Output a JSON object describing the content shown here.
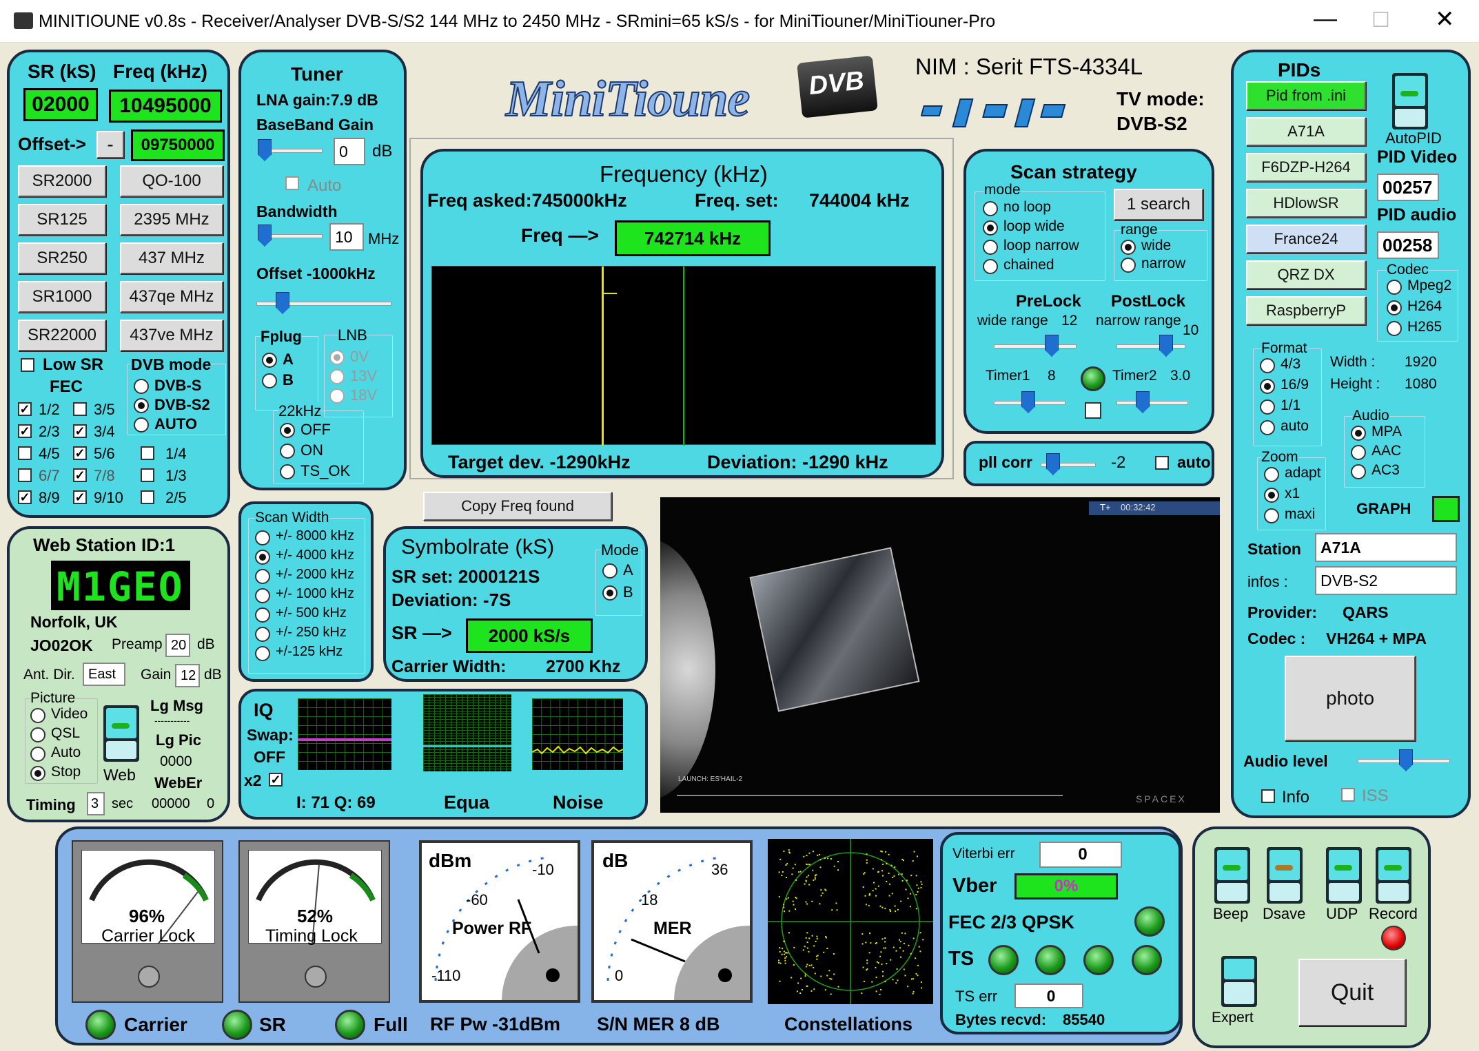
{
  "window": {
    "title": "MINITIOUNE v0.8s - Receiver/Analyser DVB-S/S2 144 MHz to 2450 MHz - SRmini=65 kS/s - for MiniTiouner/MiniTiouner-Pro"
  },
  "logo": {
    "text": "MiniTioune",
    "badge": "DVB"
  },
  "nim": {
    "label": "NIM : Serit FTS-4334L",
    "tv_mode_label": "TV mode:",
    "tv_mode_value": "DVB-S2"
  },
  "sr_freq": {
    "sr_header": "SR (kS)",
    "freq_header": "Freq (kHz)",
    "sr_value": "02000",
    "freq_value": "10495000",
    "offset_label": "Offset->",
    "offset_sign": "-",
    "offset_value": "09750000",
    "sr_buttons": [
      "SR2000",
      "SR125",
      "SR250",
      "SR1000",
      "SR22000"
    ],
    "freq_buttons": [
      "QO-100",
      "2395 MHz",
      "437 MHz",
      "437qe MHz",
      "437ve MHz"
    ],
    "low_sr_label": "Low SR",
    "fec_label": "FEC",
    "fec": [
      {
        "label": "1/2",
        "checked": true
      },
      {
        "label": "3/5",
        "checked": false
      },
      {
        "label": "2/3",
        "checked": true
      },
      {
        "label": "3/4",
        "checked": true
      },
      {
        "label": "4/5",
        "checked": false
      },
      {
        "label": "5/6",
        "checked": true
      },
      {
        "label": "6/7",
        "checked": false
      },
      {
        "label": "7/8",
        "checked": true
      },
      {
        "label": "8/9",
        "checked": true
      },
      {
        "label": "9/10",
        "checked": true
      }
    ],
    "fec_extra": [
      "1/4",
      "1/3",
      "2/5"
    ],
    "dvb_mode_label": "DVB mode",
    "dvb_modes": [
      "DVB-S",
      "DVB-S2",
      "AUTO"
    ],
    "dvb_selected": "DVB-S2"
  },
  "tuner": {
    "title": "Tuner",
    "lna": "LNA gain:7.9 dB",
    "bb_label": "BaseBand Gain",
    "bb_value": "0",
    "bb_unit": "dB",
    "auto_label": "Auto",
    "bw_label": "Bandwidth",
    "bw_value": "10",
    "bw_unit": "MHz",
    "offset_label": "Offset -1000kHz",
    "fplug_label": "Fplug",
    "fplug": [
      "A",
      "B"
    ],
    "lnb_label": "LNB",
    "lnb": [
      "0V",
      "13V",
      "18V"
    ],
    "k22_label": "22kHz",
    "k22": [
      "OFF",
      "ON",
      "TS_OK"
    ]
  },
  "frequency": {
    "title": "Frequency (kHz)",
    "asked": "Freq asked:745000kHz",
    "set_label": "Freq. set:",
    "set_value": "744004 kHz",
    "freq_label": "Freq —>",
    "freq_value": "742714 kHz",
    "target_dev": "Target dev. -1290kHz",
    "deviation": "Deviation: -1290 kHz",
    "copy_button": "Copy Freq found"
  },
  "scan": {
    "title": "Scan strategy",
    "mode_label": "mode",
    "modes": [
      "no loop",
      "loop wide",
      "loop narrow",
      "chained"
    ],
    "mode_selected": "loop wide",
    "search_button": "1 search",
    "range_label": "range",
    "ranges": [
      "wide",
      "narrow"
    ],
    "prelock": "PreLock",
    "prelock_sub": "wide range",
    "prelock_val": "12",
    "postlock": "PostLock",
    "postlock_sub": "narrow range",
    "postlock_val": "10",
    "timer1": "Timer1",
    "timer1_val": "8",
    "timer2": "Timer2",
    "timer2_val": "3.0",
    "pll_label": "pll corr",
    "pll_val": "-2",
    "pll_auto": "auto"
  },
  "pids": {
    "title": "PIDs",
    "buttons": [
      "Pid from .ini",
      "A71A",
      "F6DZP-H264",
      "HDlowSR",
      "France24",
      "QRZ DX",
      "RaspberryP"
    ],
    "autopid": "AutoPID",
    "pid_video_label": "PID Video",
    "pid_video": "00257",
    "pid_audio_label": "PID audio",
    "pid_audio": "00258",
    "codec_label": "Codec",
    "codecs": [
      "Mpeg2",
      "H264",
      "H265"
    ],
    "format_label": "Format",
    "formats": [
      "4/3",
      "16/9",
      "1/1",
      "auto"
    ],
    "width_label": "Width :",
    "width": "1920",
    "height_label": "Height :",
    "height": "1080",
    "zoom_label": "Zoom",
    "zooms": [
      "adapt",
      "x1",
      "maxi"
    ],
    "audio_label": "Audio",
    "audios": [
      "MPA",
      "AAC",
      "AC3"
    ],
    "graph_label": "GRAPH",
    "station_label": "Station",
    "station": "A71A",
    "infos_label": "infos :",
    "infos": "DVB-S2",
    "provider_label": "Provider:",
    "provider": "QARS",
    "codec_info_label": "Codec :",
    "codec_info": "VH264 + MPA",
    "photo_button": "photo",
    "audio_level": "Audio level",
    "info_label": "Info",
    "iss_label": "ISS"
  },
  "web_station": {
    "title": "Web Station ID:1",
    "callsign": "M1GEO",
    "location": "Norfolk, UK",
    "locator": "JO02OK",
    "preamp_label": "Preamp",
    "preamp": "20",
    "preamp_unit": "dB",
    "antdir_label": "Ant. Dir.",
    "antdir": "East",
    "gain_label": "Gain",
    "gain": "12",
    "gain_unit": "dB",
    "picture_label": "Picture",
    "pictures": [
      "Video",
      "QSL",
      "Auto",
      "Stop"
    ],
    "web_label": "Web",
    "lgmsg": "Lg Msg",
    "lgmsg_val": "-----------",
    "lgpic": "Lg Pic",
    "lgpic_val": "0000",
    "weber": "WebEr",
    "weber_val": "00000",
    "weber_val2": "0",
    "timing_label": "Timing",
    "timing": "3",
    "timing_unit": "sec"
  },
  "scan_width": {
    "title": "Scan Width",
    "options": [
      "+/- 8000 kHz",
      "+/- 4000 kHz",
      "+/- 2000 kHz",
      "+/- 1000 kHz",
      "+/- 500 kHz",
      "+/- 250 kHz",
      "+/-125 kHz"
    ],
    "selected": "+/- 4000 kHz"
  },
  "symbolrate": {
    "title": "Symbolrate (kS)",
    "sr_set": "SR set:  2000121S",
    "deviation": "Deviation: -7S",
    "sr_label": "SR —>",
    "sr_value": "2000 kS/s",
    "carrier": "Carrier Width:",
    "carrier_val": "2700 Khz",
    "mode_label": "Mode",
    "modes": [
      "A",
      "B"
    ]
  },
  "iq": {
    "title": "IQ",
    "swap": "Swap:",
    "swap_val": "OFF",
    "x2": "x2",
    "readout": "I: 71 Q: 69",
    "equa": "Equa",
    "noise": "Noise"
  },
  "video": {
    "overlay_time": "00:32:42",
    "overlay_tag": "T+",
    "caption": "LAUNCH: ES'HAIL-2",
    "brand": "SPACEX"
  },
  "meters": {
    "carrier_pct": "96%",
    "carrier_label": "Carrier Lock",
    "carrier_level": 0.96,
    "timing_pct": "52%",
    "timing_label": "Timing Lock",
    "timing_level": 0.52,
    "rf_unit": "dBm",
    "rf_ticks": [
      "-10",
      "-60",
      "-110"
    ],
    "rf_title": "Power RF",
    "mer_unit": "dB",
    "mer_ticks": [
      "36",
      "18",
      "0"
    ],
    "mer_title": "MER",
    "constellations": "Constellations",
    "leds": [
      "Carrier",
      "SR",
      "Full"
    ],
    "rf_pw": "RF Pw -31dBm",
    "snmer": "S/N MER   8 dB"
  },
  "status": {
    "viterbi_label": "Viterbi err",
    "viterbi": "0",
    "vber_label": "Vber",
    "vber": "0%",
    "fec_label": "FEC 2/3 QPSK",
    "ts_label": "TS",
    "ts_err_label": "TS err",
    "ts_err": "0",
    "bytes_label": "Bytes recvd:",
    "bytes": "85540"
  },
  "controls": {
    "beep": "Beep",
    "dsave": "Dsave",
    "udp": "UDP",
    "record": "Record",
    "expert": "Expert",
    "quit": "Quit"
  }
}
